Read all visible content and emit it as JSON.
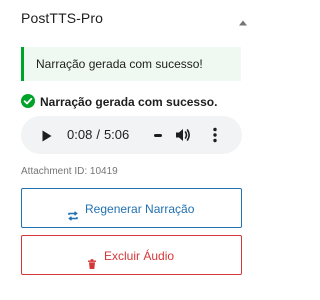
{
  "panel": {
    "title": "PostTTS-Pro",
    "toggle_icon": "chevron-up-icon"
  },
  "notice": {
    "text": "Narração gerada com sucesso!",
    "color": "#00a32a"
  },
  "status": {
    "icon": "check-circle-icon",
    "text": "Narração gerada com sucesso.",
    "color": "#00a32a"
  },
  "audio": {
    "current_time": "0:08",
    "separator": "/",
    "duration": "5:06",
    "icons": {
      "play": "play-icon",
      "volume": "volume-icon",
      "more": "more-options-icon"
    }
  },
  "attachment": {
    "text": "Attachment ID: 10419"
  },
  "buttons": {
    "regenerate": {
      "label": "Regenerar Narração",
      "icon": "refresh-icon",
      "color": "#2271b1"
    },
    "delete": {
      "label": "Excluir Áudio",
      "icon": "trash-icon",
      "color": "#d63638"
    }
  }
}
